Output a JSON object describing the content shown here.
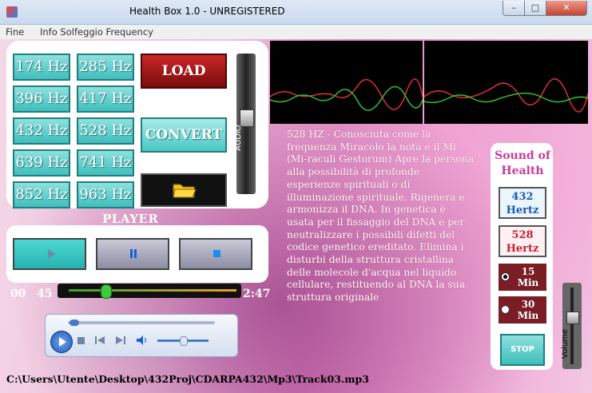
{
  "window": {
    "title": "Health Box  1.0 -   UNREGISTERED"
  },
  "menu": [
    "Fine",
    "Info Solfeggio Frequency"
  ],
  "frequencies": [
    "174 Hz",
    "285 Hz",
    "396 Hz",
    "417 Hz",
    "432 Hz",
    "528 Hz",
    "639 Hz",
    "741 Hz",
    "852 Hz",
    "963 Hz"
  ],
  "buttons": {
    "load": "LOAD FILE",
    "convert": "CONVERT",
    "audio": "AUDIO"
  },
  "player": {
    "title": "PLAYER",
    "minutes": "00",
    "seconds": "45",
    "duration": "2:47",
    "progress_fraction": 0.2
  },
  "description": "528 HZ - Conosciuta come la frequenza Miracolo la nota e il Mi (Mi-raculi Gestorum) Apre la persona alla possibilità di profonde esperienze spirituali o di illuminazione spirituale. Rigenera e armonizza il DNA. In genetica è usata per il fissaggio del DNA e per neutralizzare i possibili difetti del codice genetico ereditato. Elimina i disturbi della struttura cristallina delle molecole d'acqua nel liquido cellulare, restituendo al DNA la sua struttura originale",
  "right": {
    "title": "Sound of Health",
    "hz432": "432 Hertz",
    "hz528": "528 Hertz",
    "min15": "15 Min",
    "min30": "30 Min",
    "stop": "STOP",
    "volume": "Volume"
  },
  "file_path": "C:\\Users\\Utente\\Desktop\\432Proj\\CDARPA432\\Mp3\\Track03.mp3"
}
